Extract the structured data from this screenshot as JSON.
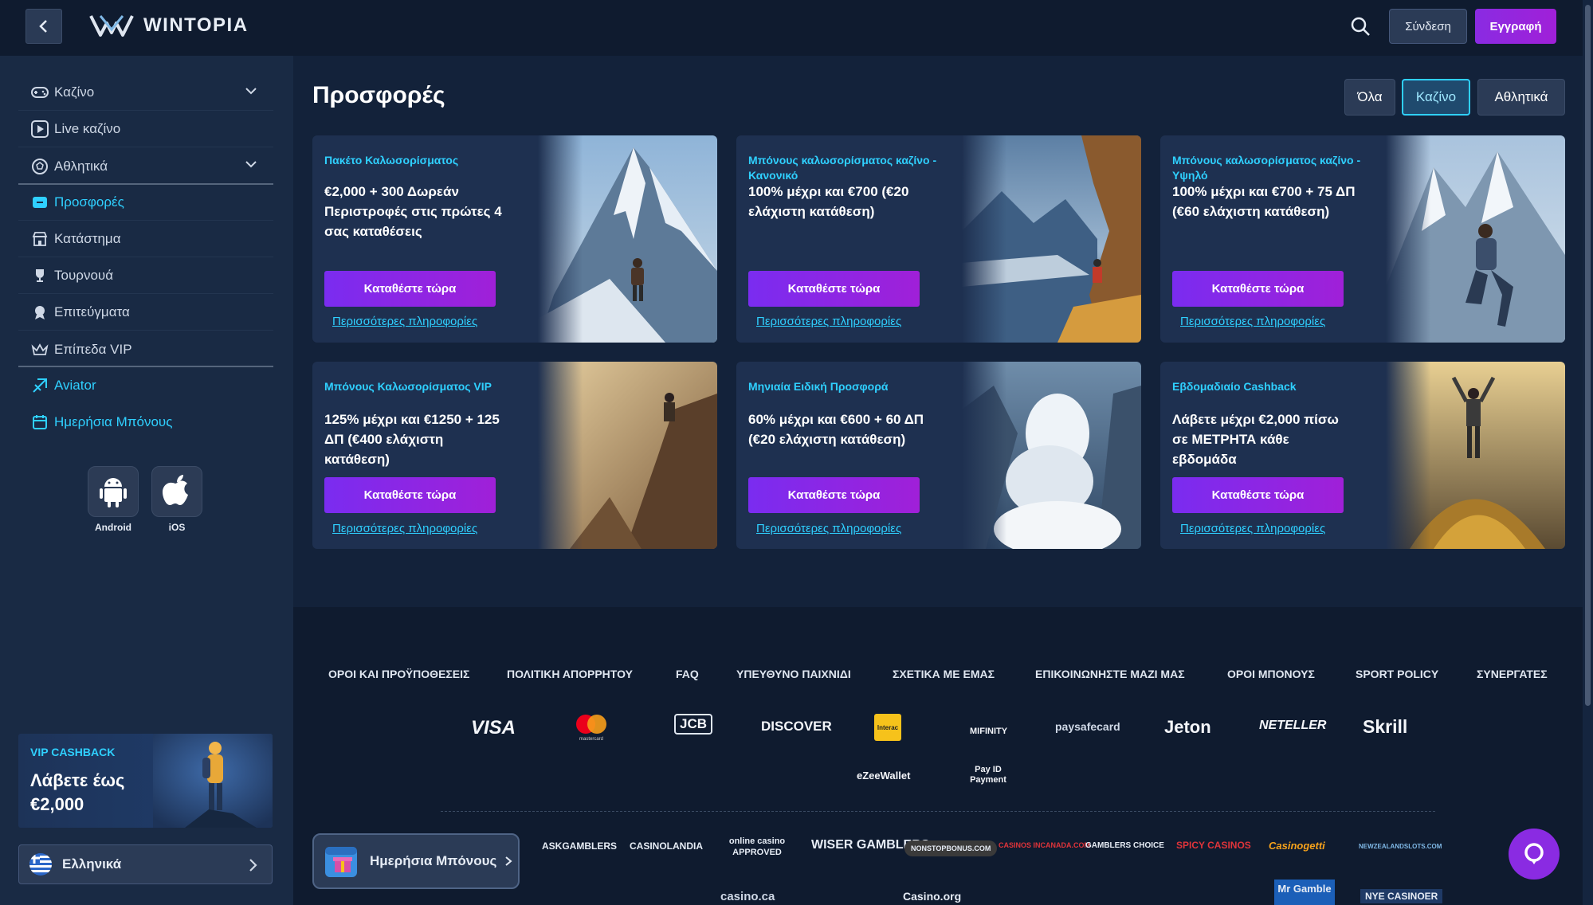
{
  "header": {
    "logo_text": "WINTOPIA",
    "login": "Σύνδεση",
    "register": "Εγγραφή"
  },
  "sidebar": {
    "items": [
      {
        "label": "Καζίνο",
        "icon": "gamepad-icon"
      },
      {
        "label": "Live καζίνο",
        "icon": "play-icon"
      },
      {
        "label": "Αθλητικά",
        "icon": "sports-icon"
      },
      {
        "label": "Προσφορές",
        "icon": "promotion-icon"
      },
      {
        "label": "Κατάστημα",
        "icon": "store-icon"
      },
      {
        "label": "Τουρνουά",
        "icon": "trophy-icon"
      },
      {
        "label": "Επιτεύγματα",
        "icon": "achievement-icon"
      },
      {
        "label": "Επίπεδα VIP",
        "icon": "crown-icon"
      },
      {
        "label": "Aviator",
        "icon": "aviator-icon"
      },
      {
        "label": "Ημερήσια Μπόνους",
        "icon": "calendar-icon"
      }
    ],
    "apps": {
      "android": "Android",
      "ios": "iOS"
    },
    "vip": {
      "tag": "VIP CASHBACK",
      "text": "Λάβετε έως €2,000"
    },
    "language": "Ελληνικά"
  },
  "main": {
    "title": "Προσφορές",
    "filters": [
      "Όλα",
      "Καζίνο",
      "Αθλητικά"
    ],
    "active_filter": "Καζίνο",
    "cards": [
      {
        "tag": "Πακέτο Καλωσορίσματος",
        "desc": "€2,000 + 300 Δωρεάν Περιστροφές στις πρώτες 4 σας καταθέσεις",
        "button": "Καταθέστε τώρα",
        "more": "Περισσότερες πληροφορίες"
      },
      {
        "tag": "Μπόνους καλωσορίσματος καζίνο - Κανονικό",
        "desc": "100% μέχρι και €700 (€20 ελάχιστη κατάθεση)",
        "button": "Καταθέστε τώρα",
        "more": "Περισσότερες πληροφορίες"
      },
      {
        "tag": "Μπόνους καλωσορίσματος καζίνο - Υψηλό",
        "desc": "100% μέχρι και €700 + 75 ΔΠ (€60 ελάχιστη κατάθεση)",
        "button": "Καταθέστε τώρα",
        "more": "Περισσότερες πληροφορίες"
      },
      {
        "tag": "Μπόνους Καλωσορίσματος VIP",
        "desc": "125% μέχρι και €1250 + 125 ΔΠ (€400 ελάχιστη κατάθεση)",
        "button": "Καταθέστε τώρα",
        "more": "Περισσότερες πληροφορίες"
      },
      {
        "tag": "Μηνιαία Ειδική Προσφορά",
        "desc": "60% μέχρι και €600 + 60 ΔΠ (€20 ελάχιστη κατάθεση)",
        "button": "Καταθέστε τώρα",
        "more": "Περισσότερες πληροφορίες"
      },
      {
        "tag": "Εβδομαδιαίο Cashback",
        "desc": "Λάβετε μέχρι €2,000 πίσω σε ΜΕΤΡΗΤΑ κάθε εβδομάδα",
        "button": "Καταθέστε τώρα",
        "more": "Περισσότερες πληροφορίες"
      }
    ]
  },
  "footer": {
    "links": [
      "ΟΡΟΙ ΚΑΙ ΠΡΟΫΠΟΘΕΣΕΙΣ",
      "ΠΟΛΙΤΙΚΗ ΑΠΟΡΡΗΤΟΥ",
      "FAQ",
      "ΥΠΕΥΘΥΝΟ ΠΑΙΧΝΙΔΙ",
      "ΣΧΕΤΙΚΑ ΜΕ ΕΜΑΣ",
      "ΕΠΙΚΟΙΝΩΝΗΣΤΕ ΜΑΖΙ ΜΑΣ",
      "ΟΡΟΙ ΜΠΟΝΟΥΣ",
      "SPORT POLICY",
      "ΣΥΝΕΡΓΑΤΕΣ"
    ],
    "payments": [
      "VISA",
      "mastercard",
      "JCB",
      "DISCOVER",
      "Interac",
      "MIFINITY",
      "paysafecard",
      "Jeton",
      "NETELLER",
      "Skrill",
      "eZeeWallet",
      "Pay ID Payment"
    ],
    "partners": [
      "ASKGAMBLERS",
      "CASINOLANDIA",
      "online casino APPROVED",
      "WISER GAMBLERS",
      "NONSTOPBONUS.COM",
      "CASINOS INCANADA.COM",
      "GAMBLERS CHOICE",
      "SPICY CASINOS",
      "Casinogetti",
      "NEWZEALANDSLOTS.COM",
      "casino.ca",
      "Casino.org",
      "Mr Gamble",
      "NYE CASINOER"
    ],
    "daily_bonus": "Ημερήσια Μπόνους"
  },
  "colors": {
    "accent": "#2fd0ff",
    "brand_purple": "#8a2be2",
    "bg": "#13223a"
  }
}
